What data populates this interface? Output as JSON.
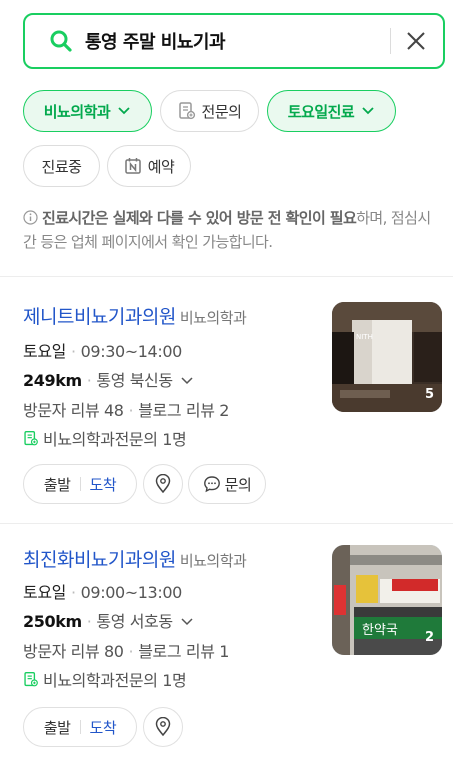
{
  "search": {
    "query": "통영 주말 비뇨기과"
  },
  "filters": [
    {
      "label": "비뇨의학과",
      "active": true,
      "icon": "chevron-down-icon"
    },
    {
      "label": "전문의",
      "active": false,
      "icon": "specialist-doc-icon"
    },
    {
      "label": "토요일진료",
      "active": true,
      "icon": "chevron-down-icon"
    },
    {
      "label": "진료중",
      "active": false
    },
    {
      "label": "예약",
      "active": false,
      "icon": "naver-booking-icon"
    }
  ],
  "notice": {
    "bold": "진료시간은 실제와 다를 수 있어 방문 전 확인이 필요",
    "rest": "하며, 점심시간 등은 업체 페이지에서 확인 가능합니다."
  },
  "results": [
    {
      "name": "제니트비뇨기과의원",
      "category": "비뇨의학과",
      "day": "토요일",
      "hours": "09:30~14:00",
      "distance": "249km",
      "area": "통영 북신동",
      "visitor_reviews": "방문자 리뷰 48",
      "blog_reviews": "블로그 리뷰 2",
      "specialist": "비뇨의학과전문의 1명",
      "photo_count": "5",
      "buttons": {
        "depart": "출발",
        "arrive": "도착",
        "inquiry": "문의"
      }
    },
    {
      "name": "최진화비뇨기과의원",
      "category": "비뇨의학과",
      "day": "토요일",
      "hours": "09:00~13:00",
      "distance": "250km",
      "area": "통영 서호동",
      "visitor_reviews": "방문자 리뷰 80",
      "blog_reviews": "블로그 리뷰 1",
      "specialist": "비뇨의학과전문의 1명",
      "photo_count": "2",
      "buttons": {
        "depart": "출발",
        "arrive": "도착"
      }
    }
  ],
  "colors": {
    "accent": "#19ce60",
    "link": "#2256c9"
  }
}
